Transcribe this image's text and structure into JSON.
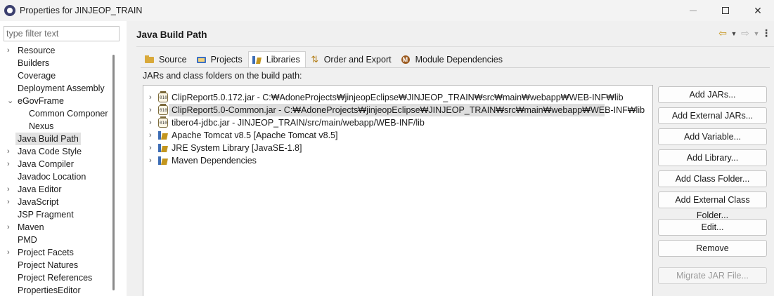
{
  "window": {
    "title": "Properties for JINJEOP_TRAIN",
    "minimize_label": "",
    "maximize_label": "",
    "close_label": "✕"
  },
  "sidebar": {
    "filter_placeholder": "type filter text",
    "items": [
      {
        "label": "Resource",
        "expandable": true
      },
      {
        "label": "Builders",
        "expandable": false
      },
      {
        "label": "Coverage",
        "expandable": false
      },
      {
        "label": "Deployment Assembly",
        "expandable": false
      },
      {
        "label": "eGovFrame",
        "expandable": true,
        "expanded": true
      },
      {
        "label": "Common Componer",
        "expandable": false,
        "child": true
      },
      {
        "label": "Nexus",
        "expandable": false,
        "child": true
      },
      {
        "label": "Java Build Path",
        "expandable": false,
        "selected": true
      },
      {
        "label": "Java Code Style",
        "expandable": true
      },
      {
        "label": "Java Compiler",
        "expandable": true
      },
      {
        "label": "Javadoc Location",
        "expandable": false
      },
      {
        "label": "Java Editor",
        "expandable": true
      },
      {
        "label": "JavaScript",
        "expandable": true
      },
      {
        "label": "JSP Fragment",
        "expandable": false
      },
      {
        "label": "Maven",
        "expandable": true
      },
      {
        "label": "PMD",
        "expandable": false
      },
      {
        "label": "Project Facets",
        "expandable": true
      },
      {
        "label": "Project Natures",
        "expandable": false
      },
      {
        "label": "Project References",
        "expandable": false
      },
      {
        "label": "PropertiesEditor",
        "expandable": false
      }
    ]
  },
  "page": {
    "title": "Java Build Path",
    "back_icon": "back-arrow-icon",
    "forward_icon": "forward-arrow-icon"
  },
  "tabs": [
    {
      "label": "Source",
      "icon": "source-folder-icon"
    },
    {
      "label": "Projects",
      "icon": "projects-icon"
    },
    {
      "label": "Libraries",
      "icon": "libraries-icon",
      "active": true
    },
    {
      "label": "Order and Export",
      "icon": "order-export-icon"
    },
    {
      "label": "Module Dependencies",
      "icon": "module-icon"
    }
  ],
  "libraries": {
    "section_label": "JARs and class folders on the build path:",
    "entries": [
      {
        "text": "ClipReport5.0.172.jar - C:₩AdoneProjects₩jinjeopEclipse₩JINJEOP_TRAIN₩src₩main₩webapp₩WEB-INF₩lib",
        "icon": "jar-icon"
      },
      {
        "text": "ClipReport5.0-Common.jar - C:₩AdoneProjects₩jinjeopEclipse₩JINJEOP_TRAIN₩src₩main₩webapp₩WEB-INF₩lib",
        "icon": "jar-icon",
        "selected": true
      },
      {
        "text": "tibero4-jdbc.jar - JINJEOP_TRAIN/src/main/webapp/WEB-INF/lib",
        "icon": "jar-icon"
      },
      {
        "text": "Apache Tomcat v8.5 [Apache Tomcat v8.5]",
        "icon": "library-icon"
      },
      {
        "text": "JRE System Library [JavaSE-1.8]",
        "icon": "library-icon"
      },
      {
        "text": "Maven Dependencies",
        "icon": "library-icon"
      }
    ]
  },
  "buttons": {
    "add_jars": "Add JARs...",
    "add_external_jars": "Add External JARs...",
    "add_variable": "Add Variable...",
    "add_library": "Add Library...",
    "add_class_folder": "Add Class Folder...",
    "add_external_class_folder": "Add External Class Folder...",
    "edit": "Edit...",
    "remove": "Remove",
    "migrate_jar": "Migrate JAR File..."
  },
  "colors": {
    "selection": "#dedede",
    "pane_bg": "#f0f0f0",
    "titlebar_bg": "#f3f3f3"
  }
}
